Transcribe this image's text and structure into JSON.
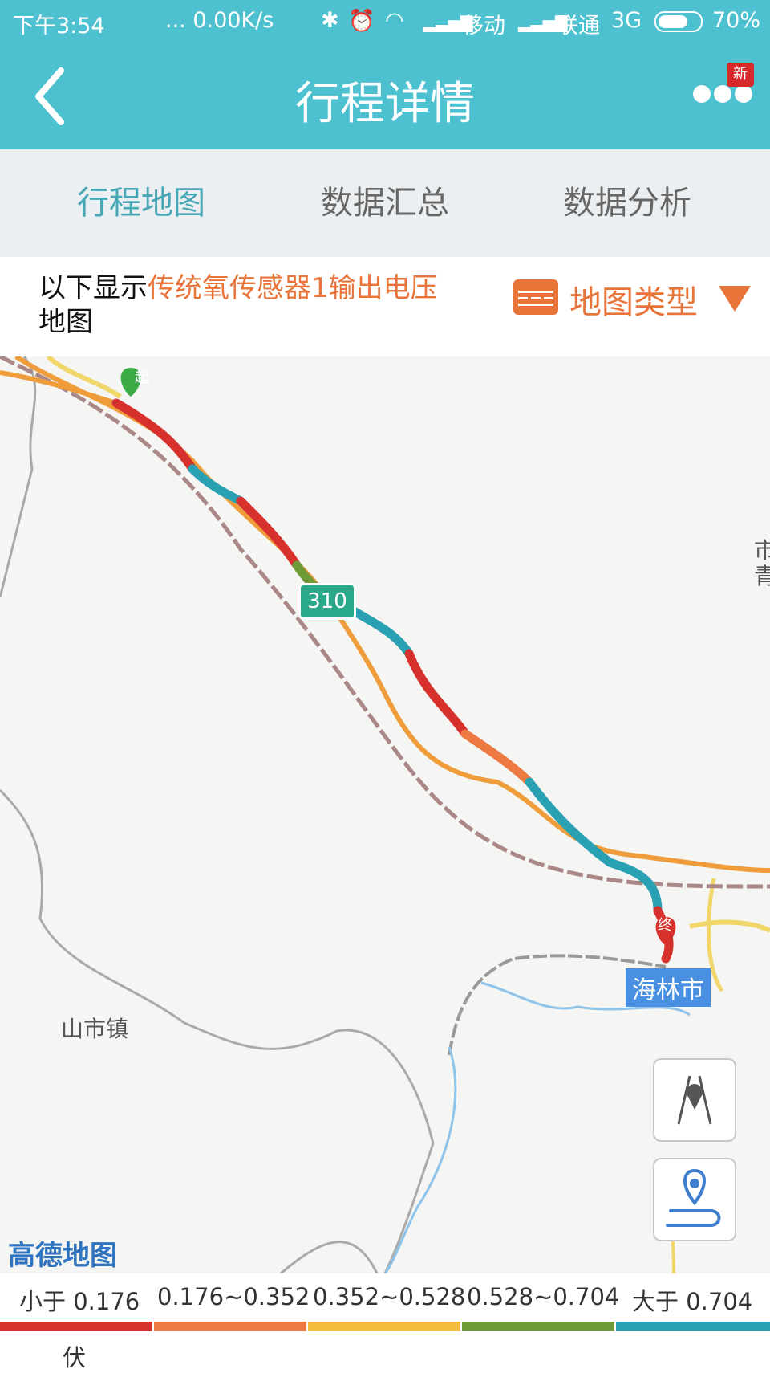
{
  "status_bar": {
    "time": "下午3:54",
    "network_speed": "... 0.00K/s",
    "carrier1": "移动",
    "carrier2": "联通",
    "network_type": "3G",
    "battery": "70%"
  },
  "app_bar": {
    "title": "行程详情",
    "badge": "新"
  },
  "tabs": [
    {
      "label": "行程地图",
      "active": true
    },
    {
      "label": "数据汇总",
      "active": false
    },
    {
      "label": "数据分析",
      "active": false
    }
  ],
  "info": {
    "prefix": "以下显示",
    "sensor": "传统氧传感器1输出电压",
    "suffix": "地图",
    "map_type_label": "地图类型"
  },
  "map": {
    "road_sign": "310",
    "city_label": "海林市",
    "town_label": "山市镇",
    "edge_label_top": "市",
    "edge_label_bottom": "青",
    "start_marker": "起",
    "end_marker": "终",
    "logo": "高德地图"
  },
  "legend": {
    "items": [
      {
        "label": "小于 0.176",
        "color": "#d7312d"
      },
      {
        "label": "0.176~0.352",
        "color": "#ee7a43"
      },
      {
        "label": "0.352~0.528",
        "color": "#f2bd3a"
      },
      {
        "label": "0.528~0.704",
        "color": "#6e9b37"
      },
      {
        "label": "大于 0.704",
        "color": "#2aa0b3"
      }
    ],
    "unit": "伏"
  }
}
